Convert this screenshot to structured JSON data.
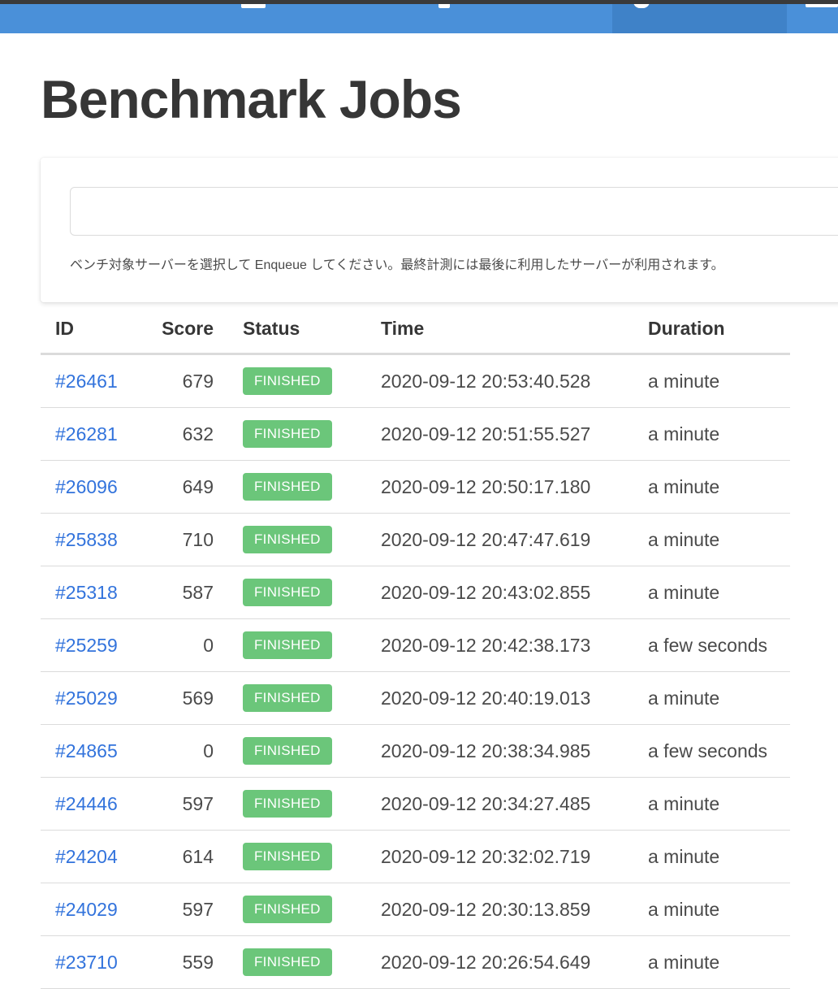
{
  "page": {
    "title": "Benchmark Jobs"
  },
  "enqueue": {
    "help_text": "ベンチ対象サーバーを選択して Enqueue してください。最終計測には最後に利用したサーバーが利用されます。",
    "select_value": ""
  },
  "table": {
    "headers": {
      "id": "ID",
      "score": "Score",
      "status": "Status",
      "time": "Time",
      "duration": "Duration"
    },
    "rows": [
      {
        "id": "#26461",
        "score": "679",
        "status": "FINISHED",
        "time": "2020-09-12 20:53:40.528",
        "duration": "a minute"
      },
      {
        "id": "#26281",
        "score": "632",
        "status": "FINISHED",
        "time": "2020-09-12 20:51:55.527",
        "duration": "a minute"
      },
      {
        "id": "#26096",
        "score": "649",
        "status": "FINISHED",
        "time": "2020-09-12 20:50:17.180",
        "duration": "a minute"
      },
      {
        "id": "#25838",
        "score": "710",
        "status": "FINISHED",
        "time": "2020-09-12 20:47:47.619",
        "duration": "a minute"
      },
      {
        "id": "#25318",
        "score": "587",
        "status": "FINISHED",
        "time": "2020-09-12 20:43:02.855",
        "duration": "a minute"
      },
      {
        "id": "#25259",
        "score": "0",
        "status": "FINISHED",
        "time": "2020-09-12 20:42:38.173",
        "duration": "a few seconds"
      },
      {
        "id": "#25029",
        "score": "569",
        "status": "FINISHED",
        "time": "2020-09-12 20:40:19.013",
        "duration": "a minute"
      },
      {
        "id": "#24865",
        "score": "0",
        "status": "FINISHED",
        "time": "2020-09-12 20:38:34.985",
        "duration": "a few seconds"
      },
      {
        "id": "#24446",
        "score": "597",
        "status": "FINISHED",
        "time": "2020-09-12 20:34:27.485",
        "duration": "a minute"
      },
      {
        "id": "#24204",
        "score": "614",
        "status": "FINISHED",
        "time": "2020-09-12 20:32:02.719",
        "duration": "a minute"
      },
      {
        "id": "#24029",
        "score": "597",
        "status": "FINISHED",
        "time": "2020-09-12 20:30:13.859",
        "duration": "a minute"
      },
      {
        "id": "#23710",
        "score": "559",
        "status": "FINISHED",
        "time": "2020-09-12 20:26:54.649",
        "duration": "a minute"
      }
    ]
  },
  "colors": {
    "navbar": "#4a90d9",
    "link": "#3273dc",
    "status_finished": "#6bc67a"
  }
}
